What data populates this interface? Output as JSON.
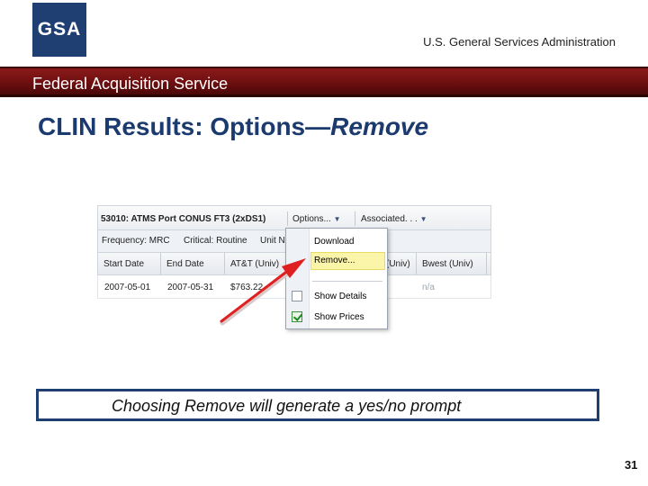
{
  "header": {
    "logo_text": "GSA",
    "agency": "U.S. General Services Administration",
    "banner": "Federal Acquisition Service",
    "brand_color": "#1f3f73",
    "banner_color": "#6e0f10"
  },
  "slide": {
    "title_prefix": "CLIN Results:  Options—",
    "title_emphasis": "Remove",
    "caption": "Choosing Remove will generate a yes/no prompt",
    "page_number": "31"
  },
  "screenshot": {
    "title": "53010: ATMS Port CONUS FT3 (2xDS1)",
    "toolbar": {
      "options_label": "Options...",
      "associated_label": "Associated. . ."
    },
    "meta": {
      "frequency": "Frequency: MRC",
      "critical": "Critical: Routine",
      "unit": "Unit Ne"
    },
    "columns": [
      "Start Date",
      "End Date",
      "AT&T (Univ)",
      "(Univ)",
      "Bwest (Univ)"
    ],
    "row": {
      "start_date": "2007-05-01",
      "end_date": "2007-05-31",
      "att_price": "$763.22",
      "bwest": "n/a"
    },
    "menu": {
      "download": "Download",
      "remove": "Remove...",
      "show_details": "Show Details",
      "show_prices": "Show Prices",
      "show_details_checked": false,
      "show_prices_checked": true
    },
    "highlight_color": "#faf5a8",
    "arrow_color": "#e02020"
  }
}
